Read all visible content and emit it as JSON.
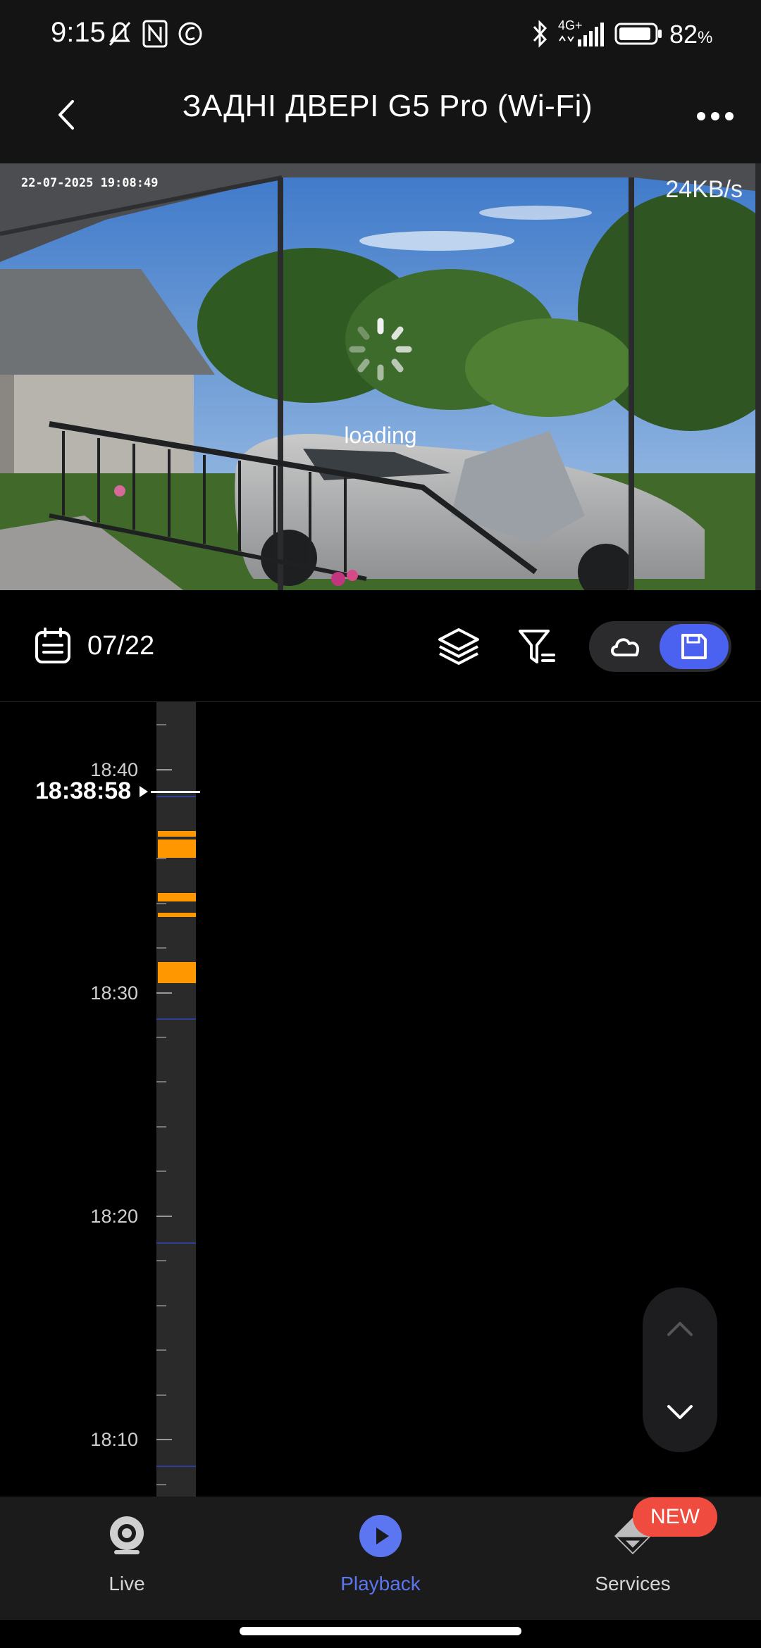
{
  "status_bar": {
    "time": "9:15",
    "network": "4G+",
    "battery_pct": "82",
    "battery_unit": "%"
  },
  "header": {
    "title": "ЗАДНІ ДВЕРІ G5 Pro (Wi-Fi)"
  },
  "video": {
    "timestamp": "22-07-2025 19:08:49",
    "bitrate": "24KB/s",
    "loading_text": "loading"
  },
  "toolbar": {
    "date": "07/22"
  },
  "timeline": {
    "current_time": "18:38:58",
    "labels": [
      "18:40",
      "18:30",
      "18:20",
      "18:10"
    ]
  },
  "scroll_control": {
    "up_icon": "chevron-up-icon",
    "down_icon": "chevron-down-icon"
  },
  "nav": {
    "live": "Live",
    "playback": "Playback",
    "services": "Services",
    "badge": "NEW"
  },
  "colors": {
    "accent": "#4b62f0",
    "event_segment": "#ff9800",
    "badge": "#f04b3f"
  }
}
